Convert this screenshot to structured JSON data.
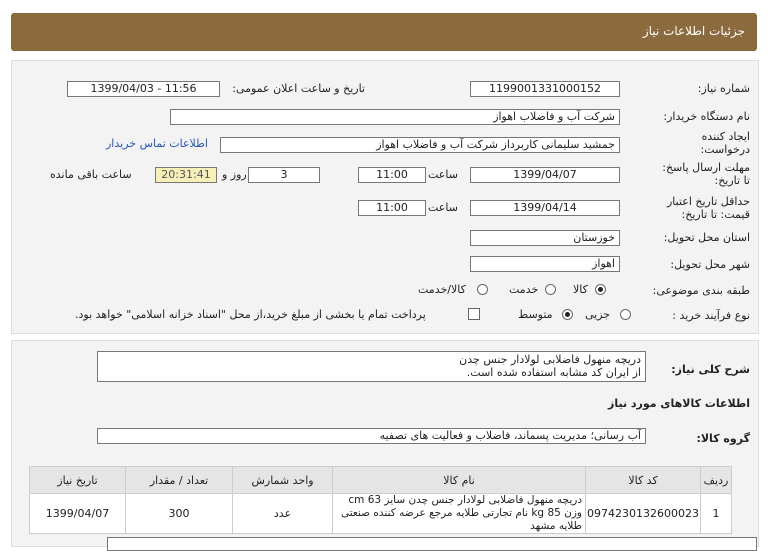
{
  "header": {
    "title": "جزئیات اطلاعات نیاز"
  },
  "form": {
    "need_number_label": "شماره نیاز:",
    "need_number": "1199001331000152",
    "announce_label": "تاریخ و ساعت اعلان عمومی:",
    "announce_value": "1399/04/03 - 11:56",
    "buyer_label": "نام دستگاه خریدار:",
    "buyer_value": "شرکت آب و فاضلاب اهواز",
    "creator_label": "ایجاد کننده درخواست:",
    "creator_value": "جمشید سلیمانی کاربرداز شرکت آب و فاضلاب اهواز",
    "contact_link": "اطلاعات تماس خریدار",
    "deadline_label": "مهلت ارسال پاسخ: تا تاریخ:",
    "deadline_date": "1399/04/07",
    "time_label": "ساعت",
    "deadline_time": "11:00",
    "days_value": "3",
    "days_label": "روز و",
    "remaining_value": "20:31:41",
    "remaining_label": "ساعت باقی مانده",
    "validity_label": "حداقل تاریخ اعتبار قیمت: تا تاریخ:",
    "validity_date": "1399/04/14",
    "validity_time": "11:00",
    "province_label": "استان محل تحویل:",
    "province_value": "خوزستان",
    "city_label": "شهر محل تحویل:",
    "city_value": "اهواز",
    "category_label": "طبقه بندی موضوعی:",
    "category_options": [
      "کالا",
      "خدمت",
      "کالا/خدمت"
    ],
    "category_selected": "کالا",
    "purchase_label": "نوع فرآیند خرید :",
    "purchase_options": [
      "جزیی",
      "متوسط"
    ],
    "purchase_selected": "متوسط",
    "payment_note": "پرداخت تمام یا بخشی از مبلغ خرید،از محل \"اسناد خزانه اسلامی\" خواهد بود."
  },
  "details": {
    "general_label": "شرح کلی نیاز:",
    "general_line1": "دریچه منهول فاضلابی لولادار جنس چدن",
    "general_line2": "از ایران کد مشابه استفاده شده است.",
    "goods_info_title": "اطلاعات کالاهای مورد نیاز",
    "group_label": "گروه کالا:",
    "group_value": "آب رسانی؛ مدیریت پسماند، فاضلاب و فعالیت های تصفیه"
  },
  "table": {
    "headers": [
      "ردیف",
      "کد کالا",
      "نام کالا",
      "واحد شمارش",
      "تعداد / مقدار",
      "تاریخ نیاز"
    ],
    "rows": [
      {
        "row": "1",
        "code": "0974230132600023",
        "name": "دریچه منهول فاضلابی لولادار جنس چدن سایز 63 cm وزن 85 kg نام تجارتی طلایه مرجع عرضه کننده صنعتی طلایه مشهد",
        "unit": "عدد",
        "qty": "300",
        "date": "1399/04/07"
      }
    ]
  },
  "colors": {
    "titlebar": "#8b6a3e",
    "link": "#2455c4",
    "remaining_bg": "#f7f0b8"
  }
}
